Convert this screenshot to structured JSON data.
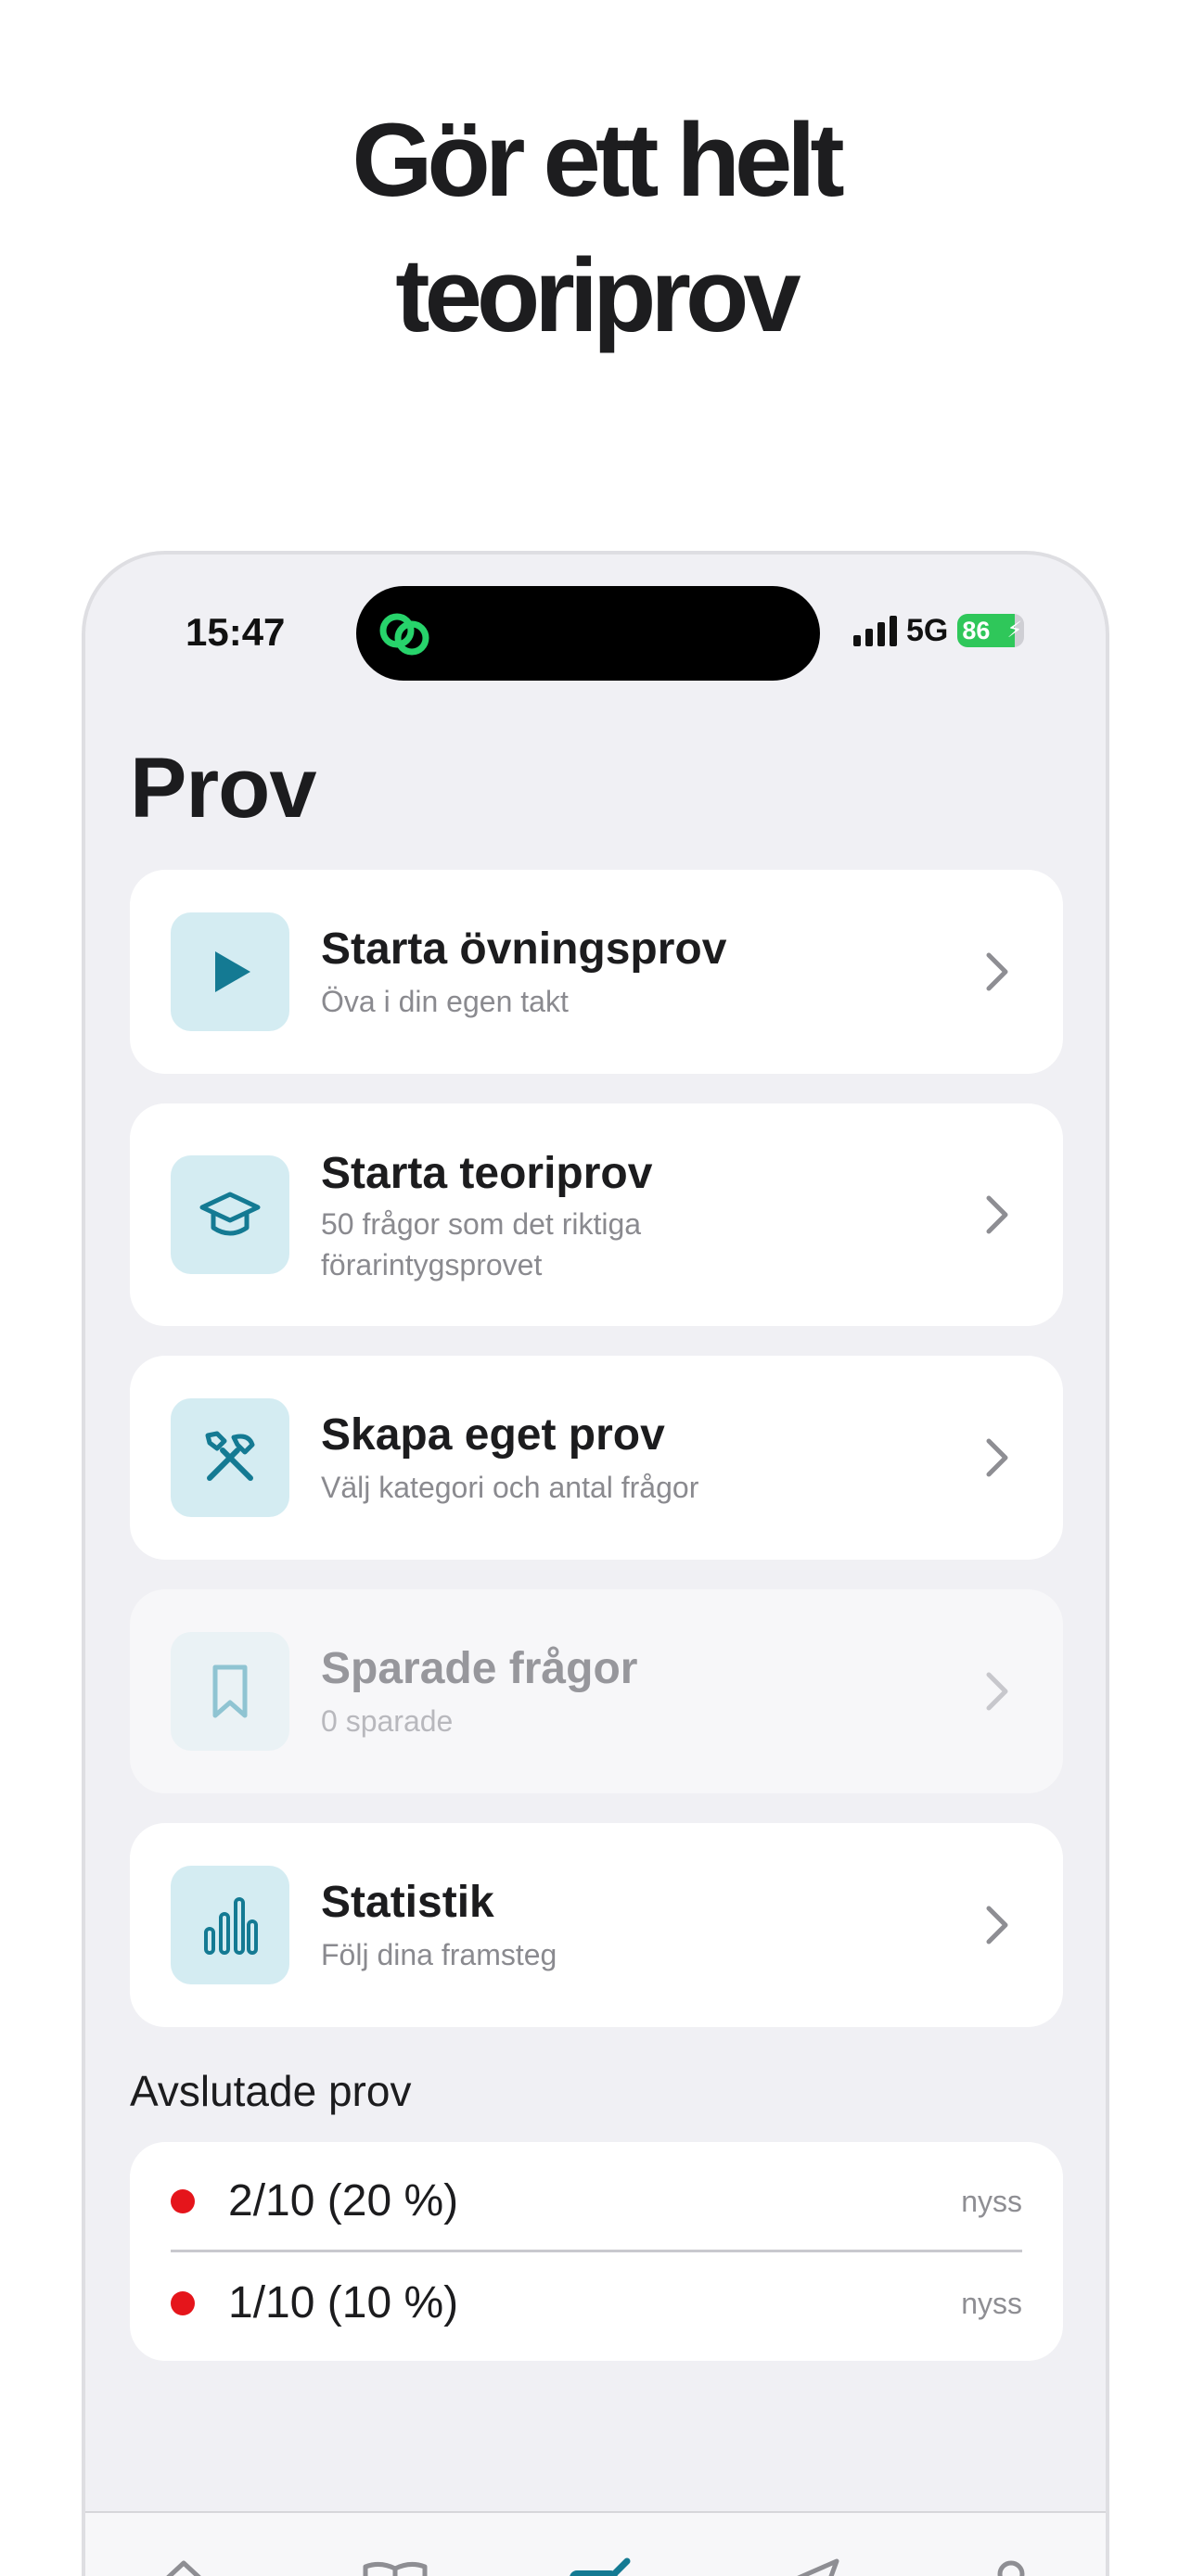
{
  "promo": {
    "line1": "Gör ett helt",
    "line2": "teoriprov"
  },
  "status_bar": {
    "time": "15:47",
    "network": "5G",
    "battery": "86"
  },
  "page": {
    "title": "Prov"
  },
  "cards": [
    {
      "title": "Starta övningsprov",
      "subtitle": "Öva i din egen takt",
      "icon": "play-icon"
    },
    {
      "title": "Starta teoriprov",
      "subtitle": "50 frågor som det riktiga förarintygsprovet",
      "icon": "graduation-cap-icon"
    },
    {
      "title": "Skapa eget prov",
      "subtitle": "Välj kategori och antal frågor",
      "icon": "tools-icon"
    },
    {
      "title": "Sparade frågor",
      "subtitle": "0 sparade",
      "icon": "bookmark-icon",
      "disabled": true
    },
    {
      "title": "Statistik",
      "subtitle": "Följ dina framsteg",
      "icon": "bar-chart-icon"
    }
  ],
  "completed": {
    "title": "Avslutade prov",
    "rows": [
      {
        "score": "2/10 (20 %)",
        "time": "nyss"
      },
      {
        "score": "1/10 (10 %)",
        "time": "nyss"
      }
    ]
  },
  "tabbar": {
    "icons": [
      "home-icon",
      "book-icon",
      "edit-icon",
      "send-icon",
      "profile-icon"
    ],
    "active": "edit-icon"
  },
  "colors": {
    "accent": "#147a93",
    "icon_bg": "#d4ecf2",
    "status_dot": "#e5151b",
    "battery": "#2fc75a"
  }
}
